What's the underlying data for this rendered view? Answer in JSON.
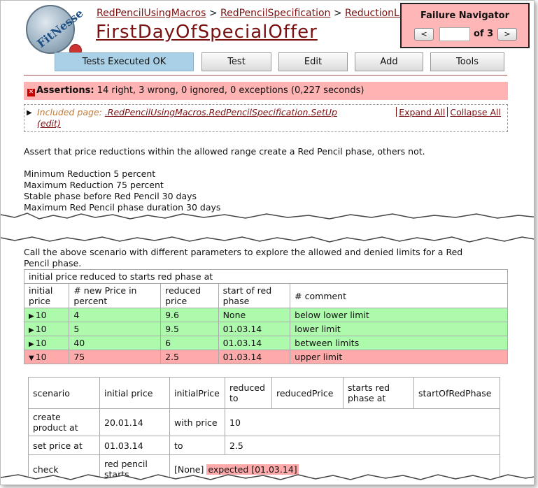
{
  "logo": {
    "text": "FitNesse"
  },
  "breadcrumb": {
    "items": [
      "RedPencilUsingMacros",
      "RedPencilSpecification",
      "ReductionLimits"
    ],
    "sep": ">"
  },
  "page_title": "FirstDayOfSpecialOffer",
  "failure_navigator": {
    "title": "Failure Navigator",
    "prev": "<",
    "next": ">",
    "of_label": "of 3",
    "current": ""
  },
  "toolbar": {
    "status": "Tests Executed OK",
    "test": "Test",
    "edit": "Edit",
    "add": "Add",
    "tools": "Tools"
  },
  "assertions": {
    "label": "Assertions:",
    "summary": "14 right, 3 wrong, 0 ignored, 0 exceptions (0,227 seconds)"
  },
  "included": {
    "label": "Included page:",
    "link": ".RedPencilUsingMacros.RedPencilSpecification.SetUp",
    "edit": "(edit)",
    "expand_all": "Expand All",
    "collapse_all": "Collapse All"
  },
  "description": {
    "intro": "Assert that price reductions within the allowed range create a Red Pencil phase, others not.",
    "params": [
      "Minimum Reduction 5 percent",
      "Maximum Reduction 75 percent",
      "Stable phase before Red Pencil 30 days",
      "Maximum Red Pencil phase duration 30 days"
    ]
  },
  "call_text": {
    "line1": "Call the above scenario with different parameters to explore the allowed and denied limits for a Red",
    "line2": "Pencil phase."
  },
  "table": {
    "title": "initial price reduced to starts red phase at",
    "headers": [
      [
        "initial",
        "price"
      ],
      [
        "# new Price in",
        "percent"
      ],
      [
        "reduced",
        "price"
      ],
      [
        "start of red",
        "phase"
      ],
      [
        "# comment",
        ""
      ]
    ],
    "rows": [
      {
        "cells": [
          "10",
          "4",
          "9.6",
          "None",
          "below lower limit"
        ],
        "status": "pass",
        "arrow": "▶"
      },
      {
        "cells": [
          "10",
          "5",
          "9.5",
          "01.03.14",
          "lower limit"
        ],
        "status": "pass",
        "arrow": "▶"
      },
      {
        "cells": [
          "10",
          "40",
          "6",
          "01.03.14",
          "between limits"
        ],
        "status": "pass",
        "arrow": "▶"
      },
      {
        "cells": [
          "10",
          "75",
          "2.5",
          "01.03.14",
          "upper limit"
        ],
        "status": "fail",
        "arrow": "▼"
      }
    ]
  },
  "scenario": {
    "header": [
      "scenario",
      "initial price",
      "initialPrice",
      "reduced to",
      "reducedPrice",
      "starts red phase at",
      "startOfRedPhase"
    ],
    "rows": [
      {
        "cells": [
          "create product at",
          "20.01.14",
          "with price",
          "10"
        ]
      },
      {
        "cells": [
          "set price at",
          "01.03.14",
          "to",
          "2.5"
        ]
      },
      {
        "cells": [
          "check",
          "red pencil starts",
          "[None]",
          "expected [01.03.14]"
        ]
      }
    ]
  },
  "colors": {
    "pass": "#adfaad",
    "fail": "#ffaaaa",
    "link": "#7a1010",
    "assert_bg": "#ffb3b3"
  }
}
